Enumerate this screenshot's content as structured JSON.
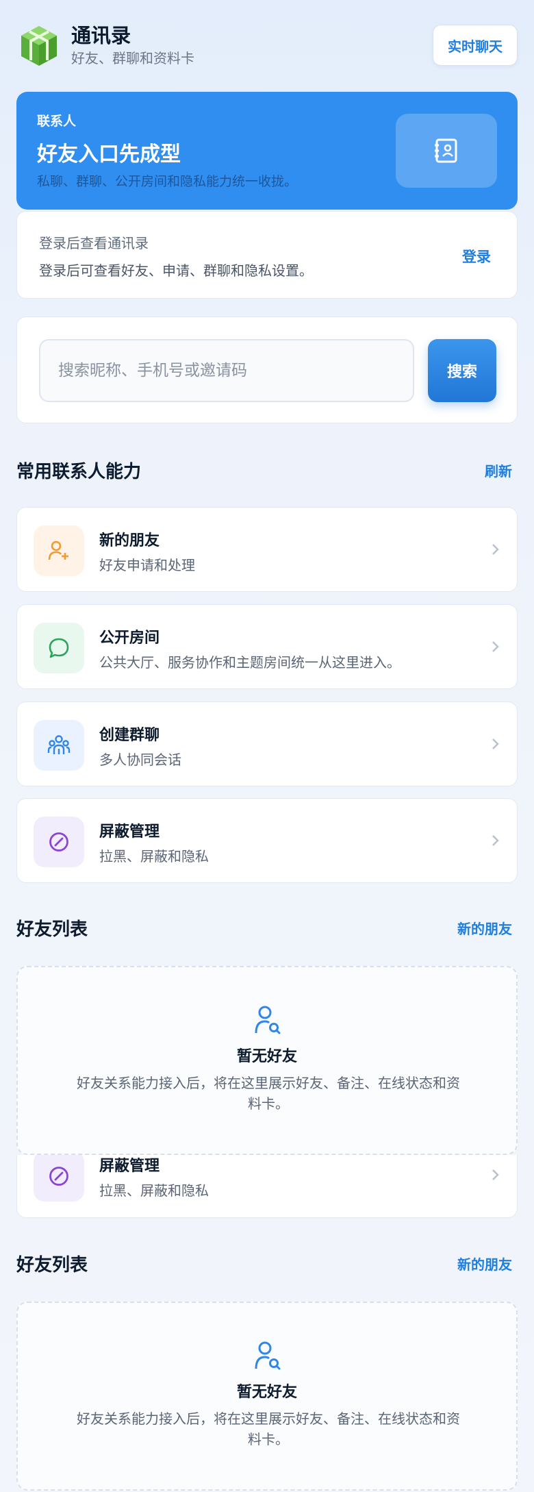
{
  "header": {
    "title": "通讯录",
    "subtitle": "好友、群聊和资料卡",
    "chat_button": "实时聊天"
  },
  "hero": {
    "kicker": "联系人",
    "title": "好友入口先成型",
    "description": "私聊、群聊、公开房间和隐私能力统一收拢。"
  },
  "login": {
    "title": "登录后查看通讯录",
    "description": "登录后可查看好友、申请、群聊和隐私设置。",
    "action": "登录"
  },
  "search": {
    "placeholder": "搜索昵称、手机号或邀请码",
    "button": "搜索"
  },
  "features_section": {
    "title": "常用联系人能力",
    "action": "刷新"
  },
  "features": [
    {
      "title": "新的朋友",
      "desc": "好友申请和处理",
      "icon": "add-user-icon",
      "color": "#f39a2e"
    },
    {
      "title": "公开房间",
      "desc": "公共大厅、服务协作和主题房间统一从这里进入。",
      "icon": "chat-bubble-icon",
      "color": "#28a55a"
    },
    {
      "title": "创建群聊",
      "desc": "多人协同会话",
      "icon": "group-icon",
      "color": "#2f86e8"
    },
    {
      "title": "屏蔽管理",
      "desc": "拉黑、屏蔽和隐私",
      "icon": "block-icon",
      "color": "#8a45d6"
    }
  ],
  "friends_section": {
    "title": "好友列表",
    "action": "新的朋友"
  },
  "empty": {
    "title": "暂无好友",
    "description": "好友关系能力接入后，将在这里展示好友、备注、在线状态和资料卡。"
  },
  "colors": {
    "accent": "#1f7fe0",
    "hero_bg": "#2f8ef0"
  }
}
